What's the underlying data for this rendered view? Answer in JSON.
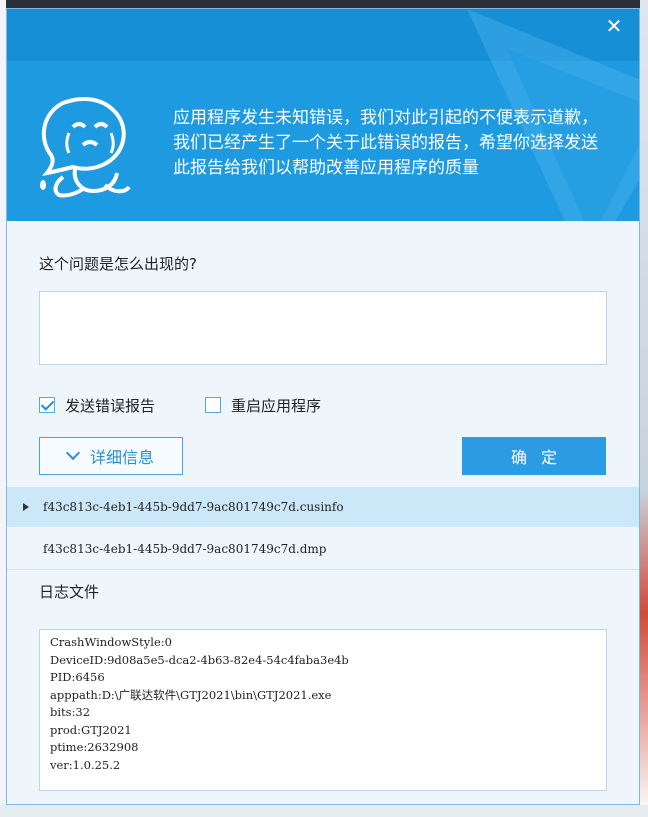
{
  "window": {
    "close_icon": "close-icon",
    "message": "应用程序发生未知错误，我们对此引起的不便表示道歉，我们已经产生了一个关于此错误的报告，希望你选择发送此报告给我们以帮助改善应用程序的质量"
  },
  "form": {
    "question_label": "这个问题是怎么出现的?",
    "description_value": "",
    "send_report_label": "发送错误报告",
    "send_report_checked": true,
    "restart_label": "重启应用程序",
    "restart_checked": false,
    "details_label": "详细信息",
    "ok_label": "确定"
  },
  "files": [
    {
      "name": "f43c813c-4eb1-445b-9dd7-9ac801749c7d.cusinfo",
      "selected": true
    },
    {
      "name": "f43c813c-4eb1-445b-9dd7-9ac801749c7d.dmp",
      "selected": false
    }
  ],
  "log": {
    "label": "日志文件",
    "lines": [
      "CrashWindowStyle:0",
      "DeviceID:9d08a5e5-dca2-4b63-82e4-54c4faba3e4b",
      "PID:6456",
      "apppath:D:\\广联达软件\\GTJ2021\\bin\\GTJ2021.exe",
      "bits:32",
      "prod:GTJ2021",
      "ptime:2632908",
      "ver:1.0.25.2"
    ]
  },
  "colors": {
    "header": "#1e9be0",
    "accent": "#2b9be3",
    "selected_row": "#cbe7f8"
  }
}
